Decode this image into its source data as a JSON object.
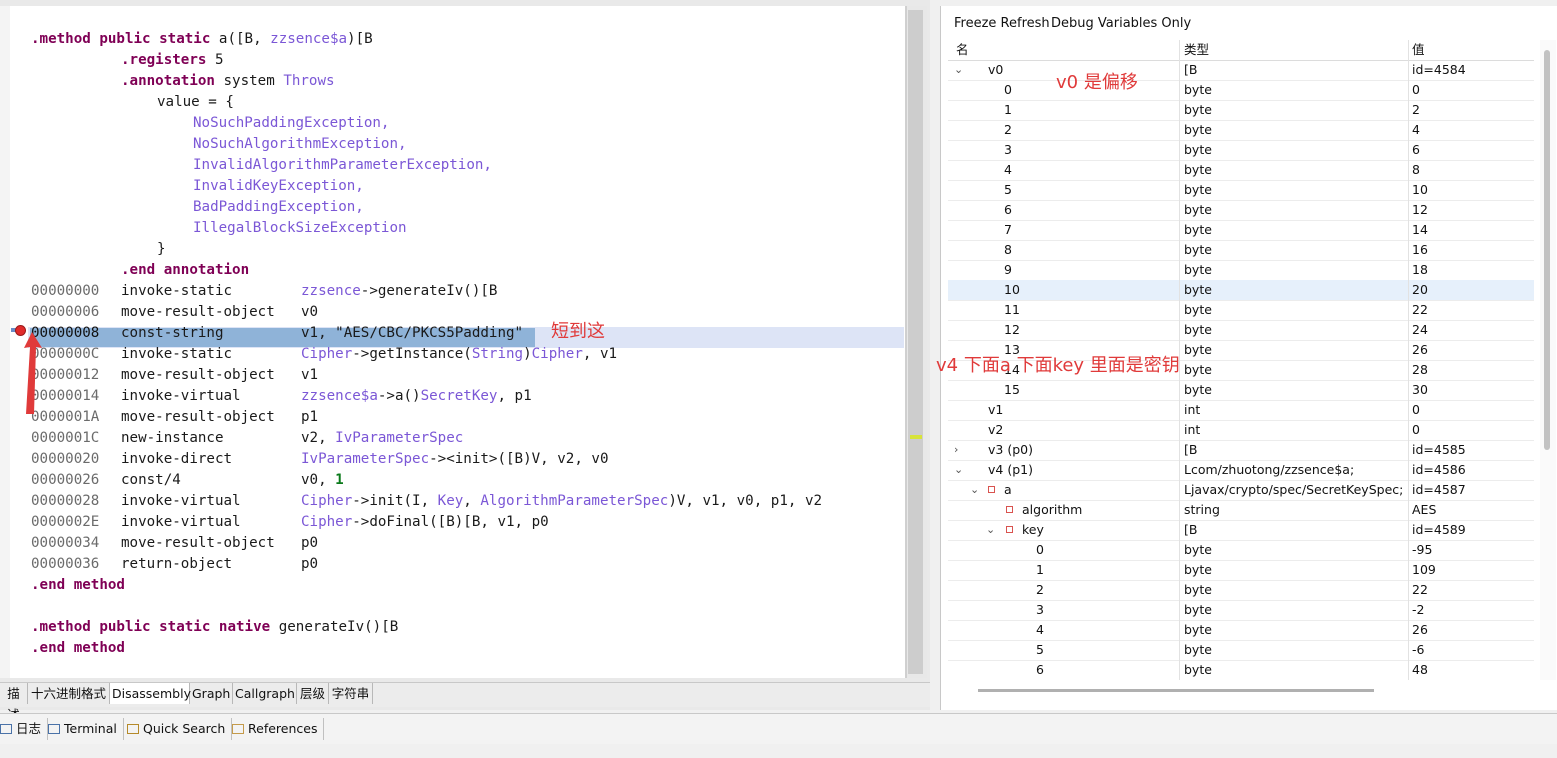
{
  "code": {
    "lines": {
      "l1_a": ".method public static",
      "l1_b": " a([B, ",
      "l1_c": "zzsence$a",
      "l1_d": ")[B",
      "l2_a": ".registers",
      "l2_b": " 5",
      "l3_a": ".annotation",
      "l3_b": " system ",
      "l3_c": "Throws",
      "l4": "value = {",
      "l5": "NoSuchPaddingException,",
      "l6": "NoSuchAlgorithmException,",
      "l7": "InvalidAlgorithmParameterException,",
      "l8": "InvalidKeyException,",
      "l9": "BadPaddingException,",
      "l10": "IllegalBlockSizeException",
      "l11": "}",
      "l12": ".end annotation",
      "end_method": ".end method",
      "m2_a": ".method public static native",
      "m2_b": " generateIv()[B",
      "end_method2": ".end method"
    },
    "instructions": [
      {
        "addr": "00000000",
        "op": "invoke-static",
        "arg_type": "zzsence",
        "arg_rest": "->generateIv()[B"
      },
      {
        "addr": "00000006",
        "op": "move-result-object",
        "arg_plain": "v0"
      },
      {
        "addr": "00000008",
        "op": "const-string",
        "arg_plain": "v1, \"AES/CBC/PKCS5Padding\""
      },
      {
        "addr": "0000000C",
        "op": "invoke-static",
        "t1": "Cipher",
        "r1": "->getInstance(",
        "t2": "String",
        "r2": ")",
        "t3": "Cipher",
        "r3": ", v1"
      },
      {
        "addr": "00000012",
        "op": "move-result-object",
        "arg_plain": "v1"
      },
      {
        "addr": "00000014",
        "op": "invoke-virtual",
        "t1": "zzsence$a",
        "r1": "->a()",
        "t2": "SecretKey",
        "r2": ", p1"
      },
      {
        "addr": "0000001A",
        "op": "move-result-object",
        "arg_plain": "p1"
      },
      {
        "addr": "0000001C",
        "op": "new-instance",
        "r0": "v2, ",
        "t1": "IvParameterSpec"
      },
      {
        "addr": "00000020",
        "op": "invoke-direct",
        "t1": "IvParameterSpec",
        "r1": "-><init>([B)V, v2, v0"
      },
      {
        "addr": "00000026",
        "op": "const/4",
        "r0": "v0, ",
        "n1": "1"
      },
      {
        "addr": "00000028",
        "op": "invoke-virtual",
        "t1": "Cipher",
        "r1": "->init(I, ",
        "t2": "Key",
        "r2": ", ",
        "t3": "AlgorithmParameterSpec",
        "r3": ")V, v1, v0, p1, v2"
      },
      {
        "addr": "0000002E",
        "op": "invoke-virtual",
        "t1": "Cipher",
        "r1": "->doFinal([B)[B, v1, p0"
      },
      {
        "addr": "00000034",
        "op": "move-result-object",
        "arg_plain": "p0"
      },
      {
        "addr": "00000036",
        "op": "return-object",
        "arg_plain": "p0"
      }
    ]
  },
  "tabs": [
    "描述",
    "十六进制格式",
    "Disassembly",
    "Graph",
    "Callgraph",
    "层级",
    "字符串"
  ],
  "active_tab": "Disassembly",
  "variables": {
    "toolbar": {
      "freeze": "Freeze Refresh",
      "debug_only": "Debug Variables Only"
    },
    "headers": {
      "name": "名",
      "type": "类型",
      "value": "值"
    },
    "rows": [
      {
        "name": "v0",
        "type": "[B",
        "value": "id=4584",
        "caret": "⌄"
      },
      {
        "name": "0",
        "type": "byte",
        "value": "0"
      },
      {
        "name": "1",
        "type": "byte",
        "value": "2"
      },
      {
        "name": "2",
        "type": "byte",
        "value": "4"
      },
      {
        "name": "3",
        "type": "byte",
        "value": "6"
      },
      {
        "name": "4",
        "type": "byte",
        "value": "8"
      },
      {
        "name": "5",
        "type": "byte",
        "value": "10"
      },
      {
        "name": "6",
        "type": "byte",
        "value": "12"
      },
      {
        "name": "7",
        "type": "byte",
        "value": "14"
      },
      {
        "name": "8",
        "type": "byte",
        "value": "16"
      },
      {
        "name": "9",
        "type": "byte",
        "value": "18"
      },
      {
        "name": "10",
        "type": "byte",
        "value": "20"
      },
      {
        "name": "11",
        "type": "byte",
        "value": "22"
      },
      {
        "name": "12",
        "type": "byte",
        "value": "24"
      },
      {
        "name": "13",
        "type": "byte",
        "value": "26"
      },
      {
        "name": "14",
        "type": "byte",
        "value": "28"
      },
      {
        "name": "15",
        "type": "byte",
        "value": "30"
      },
      {
        "name": "v1",
        "type": "int",
        "value": "0"
      },
      {
        "name": "v2",
        "type": "int",
        "value": "0"
      },
      {
        "name": "v3 (p0)",
        "type": "[B",
        "value": "id=4585",
        "caret": "›"
      },
      {
        "name": "v4 (p1)",
        "type": "Lcom/zhuotong/zzsence$a;",
        "value": "id=4586",
        "caret": "⌄"
      },
      {
        "name": "a",
        "type": "Ljavax/crypto/spec/SecretKeySpec;",
        "value": "id=4587",
        "caret": "⌄"
      },
      {
        "name": "algorithm",
        "type": "string",
        "value": "AES"
      },
      {
        "name": "key",
        "type": "[B",
        "value": "id=4589",
        "caret": "⌄"
      },
      {
        "name": "0",
        "type": "byte",
        "value": "-95"
      },
      {
        "name": "1",
        "type": "byte",
        "value": "109"
      },
      {
        "name": "2",
        "type": "byte",
        "value": "22"
      },
      {
        "name": "3",
        "type": "byte",
        "value": "-2"
      },
      {
        "name": "4",
        "type": "byte",
        "value": "26"
      },
      {
        "name": "5",
        "type": "byte",
        "value": "-6"
      },
      {
        "name": "6",
        "type": "byte",
        "value": "48"
      }
    ]
  },
  "bottom_tabs": [
    "日志",
    "Terminal",
    "Quick Search",
    "References"
  ],
  "annotations": {
    "break_here": "短到这",
    "v0_note": "v0 是偏移",
    "v4_note": "v4 下面a 下面key 里面是密钥"
  },
  "colors": {
    "annotation": "#e03a3a",
    "keyword": "#7f0055",
    "type": "#7b57d6",
    "selection": "#8fb3d8"
  }
}
